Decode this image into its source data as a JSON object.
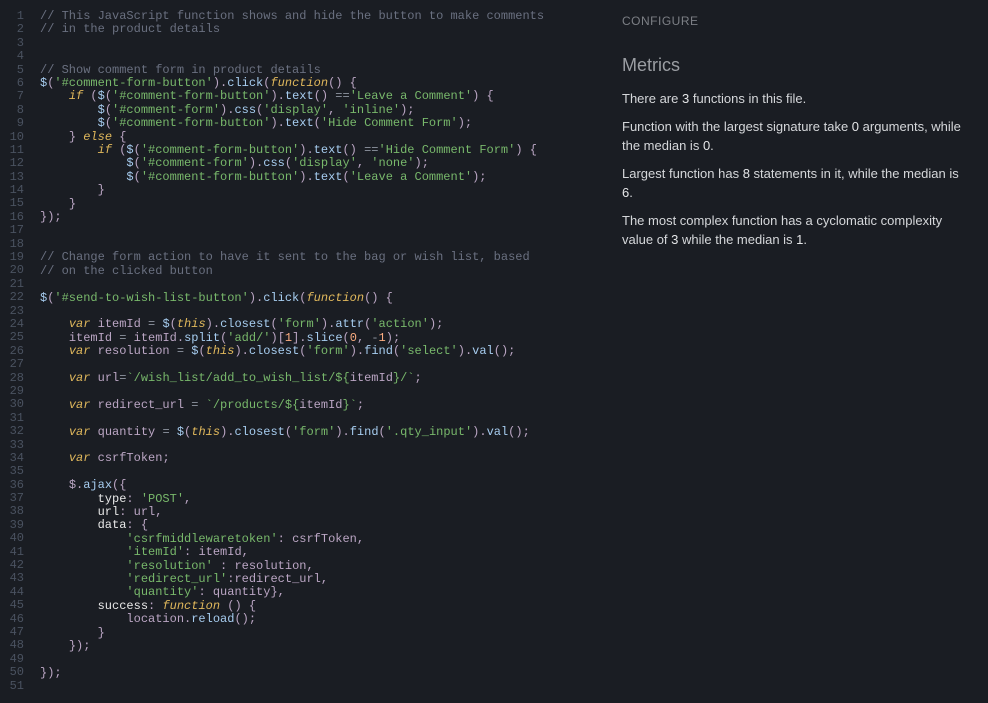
{
  "sidebar": {
    "configure_label": "CONFIGURE",
    "metrics_heading": "Metrics",
    "metrics": {
      "functions_count": 3,
      "largest_signature_args": 0,
      "median_args": 0,
      "largest_statements": 8,
      "median_statements": 6,
      "max_cyclomatic": 3,
      "median_cyclomatic": 1
    }
  },
  "code": {
    "line_count": 51,
    "lines": [
      [
        [
          "comment",
          "// This JavaScript function shows and hide the button to make comments"
        ]
      ],
      [
        [
          "comment",
          "// in the product details"
        ]
      ],
      [],
      [],
      [
        [
          "comment",
          "// Show comment form in product details"
        ]
      ],
      [
        [
          "fn",
          "$"
        ],
        [
          "punc",
          "("
        ],
        [
          "str",
          "'#comment-form-button'"
        ],
        [
          "punc",
          ")."
        ],
        [
          "fn",
          "click"
        ],
        [
          "punc",
          "("
        ],
        [
          "kw",
          "function"
        ],
        [
          "punc",
          "() {"
        ]
      ],
      [
        [
          "plain",
          "    "
        ],
        [
          "kw",
          "if"
        ],
        [
          "plain",
          " "
        ],
        [
          "punc",
          "("
        ],
        [
          "fn",
          "$"
        ],
        [
          "punc",
          "("
        ],
        [
          "str",
          "'#comment-form-button'"
        ],
        [
          "punc",
          ")."
        ],
        [
          "fn",
          "text"
        ],
        [
          "punc",
          "() "
        ],
        [
          "op",
          "=="
        ],
        [
          "str",
          "'Leave a Comment'"
        ],
        [
          "punc",
          ") {"
        ]
      ],
      [
        [
          "plain",
          "        "
        ],
        [
          "fn",
          "$"
        ],
        [
          "punc",
          "("
        ],
        [
          "str",
          "'#comment-form'"
        ],
        [
          "punc",
          ")."
        ],
        [
          "fn",
          "css"
        ],
        [
          "punc",
          "("
        ],
        [
          "str",
          "'display'"
        ],
        [
          "punc",
          ", "
        ],
        [
          "str",
          "'inline'"
        ],
        [
          "punc",
          ");"
        ]
      ],
      [
        [
          "plain",
          "        "
        ],
        [
          "fn",
          "$"
        ],
        [
          "punc",
          "("
        ],
        [
          "str",
          "'#comment-form-button'"
        ],
        [
          "punc",
          ")."
        ],
        [
          "fn",
          "text"
        ],
        [
          "punc",
          "("
        ],
        [
          "str",
          "'Hide Comment Form'"
        ],
        [
          "punc",
          ");"
        ]
      ],
      [
        [
          "plain",
          "    "
        ],
        [
          "punc",
          "} "
        ],
        [
          "kw",
          "else"
        ],
        [
          "plain",
          " "
        ],
        [
          "punc",
          "{"
        ]
      ],
      [
        [
          "plain",
          "        "
        ],
        [
          "kw",
          "if"
        ],
        [
          "plain",
          " "
        ],
        [
          "punc",
          "("
        ],
        [
          "fn",
          "$"
        ],
        [
          "punc",
          "("
        ],
        [
          "str",
          "'#comment-form-button'"
        ],
        [
          "punc",
          ")."
        ],
        [
          "fn",
          "text"
        ],
        [
          "punc",
          "() "
        ],
        [
          "op",
          "=="
        ],
        [
          "str",
          "'Hide Comment Form'"
        ],
        [
          "punc",
          ") {"
        ]
      ],
      [
        [
          "plain",
          "            "
        ],
        [
          "fn",
          "$"
        ],
        [
          "punc",
          "("
        ],
        [
          "str",
          "'#comment-form'"
        ],
        [
          "punc",
          ")."
        ],
        [
          "fn",
          "css"
        ],
        [
          "punc",
          "("
        ],
        [
          "str",
          "'display'"
        ],
        [
          "punc",
          ", "
        ],
        [
          "str",
          "'none'"
        ],
        [
          "punc",
          ");"
        ]
      ],
      [
        [
          "plain",
          "            "
        ],
        [
          "fn",
          "$"
        ],
        [
          "punc",
          "("
        ],
        [
          "str",
          "'#comment-form-button'"
        ],
        [
          "punc",
          ")."
        ],
        [
          "fn",
          "text"
        ],
        [
          "punc",
          "("
        ],
        [
          "str",
          "'Leave a Comment'"
        ],
        [
          "punc",
          ");"
        ]
      ],
      [
        [
          "plain",
          "        "
        ],
        [
          "punc",
          "}"
        ]
      ],
      [
        [
          "plain",
          "    "
        ],
        [
          "punc",
          "}"
        ]
      ],
      [
        [
          "punc",
          "});"
        ]
      ],
      [],
      [],
      [
        [
          "comment",
          "// Change form action to have it sent to the bag or wish list, based"
        ]
      ],
      [
        [
          "comment",
          "// on the clicked button"
        ]
      ],
      [],
      [
        [
          "fn",
          "$"
        ],
        [
          "punc",
          "("
        ],
        [
          "str",
          "'#send-to-wish-list-button'"
        ],
        [
          "punc",
          ")."
        ],
        [
          "fn",
          "click"
        ],
        [
          "punc",
          "("
        ],
        [
          "kw",
          "function"
        ],
        [
          "punc",
          "() {"
        ]
      ],
      [],
      [
        [
          "plain",
          "    "
        ],
        [
          "kw",
          "var"
        ],
        [
          "plain",
          " "
        ],
        [
          "ident",
          "itemId"
        ],
        [
          "plain",
          " "
        ],
        [
          "op",
          "="
        ],
        [
          "plain",
          " "
        ],
        [
          "fn",
          "$"
        ],
        [
          "punc",
          "("
        ],
        [
          "kw",
          "this"
        ],
        [
          "punc",
          ")."
        ],
        [
          "fn",
          "closest"
        ],
        [
          "punc",
          "("
        ],
        [
          "str",
          "'form'"
        ],
        [
          "punc",
          ")."
        ],
        [
          "fn",
          "attr"
        ],
        [
          "punc",
          "("
        ],
        [
          "str",
          "'action'"
        ],
        [
          "punc",
          ");"
        ]
      ],
      [
        [
          "plain",
          "    "
        ],
        [
          "ident",
          "itemId"
        ],
        [
          "plain",
          " "
        ],
        [
          "op",
          "="
        ],
        [
          "plain",
          " "
        ],
        [
          "ident",
          "itemId"
        ],
        [
          "punc",
          "."
        ],
        [
          "fn",
          "split"
        ],
        [
          "punc",
          "("
        ],
        [
          "str",
          "'add/'"
        ],
        [
          "punc",
          ")["
        ],
        [
          "num",
          "1"
        ],
        [
          "punc",
          "]."
        ],
        [
          "fn",
          "slice"
        ],
        [
          "punc",
          "("
        ],
        [
          "num",
          "0"
        ],
        [
          "punc",
          ", "
        ],
        [
          "op",
          "-"
        ],
        [
          "num",
          "1"
        ],
        [
          "punc",
          ");"
        ]
      ],
      [
        [
          "plain",
          "    "
        ],
        [
          "kw",
          "var"
        ],
        [
          "plain",
          " "
        ],
        [
          "ident",
          "resolution"
        ],
        [
          "plain",
          " "
        ],
        [
          "op",
          "="
        ],
        [
          "plain",
          " "
        ],
        [
          "fn",
          "$"
        ],
        [
          "punc",
          "("
        ],
        [
          "kw",
          "this"
        ],
        [
          "punc",
          ")."
        ],
        [
          "fn",
          "closest"
        ],
        [
          "punc",
          "("
        ],
        [
          "str",
          "'form'"
        ],
        [
          "punc",
          ")."
        ],
        [
          "fn",
          "find"
        ],
        [
          "punc",
          "("
        ],
        [
          "str",
          "'select'"
        ],
        [
          "punc",
          ")."
        ],
        [
          "fn",
          "val"
        ],
        [
          "punc",
          "();"
        ]
      ],
      [],
      [
        [
          "plain",
          "    "
        ],
        [
          "kw",
          "var"
        ],
        [
          "plain",
          " "
        ],
        [
          "ident",
          "url"
        ],
        [
          "op",
          "="
        ],
        [
          "str",
          "`/wish_list/add_to_wish_list/${"
        ],
        [
          "ident",
          "itemId"
        ],
        [
          "str",
          "}/`"
        ],
        [
          "punc",
          ";"
        ]
      ],
      [],
      [
        [
          "plain",
          "    "
        ],
        [
          "kw",
          "var"
        ],
        [
          "plain",
          " "
        ],
        [
          "ident",
          "redirect_url"
        ],
        [
          "plain",
          " "
        ],
        [
          "op",
          "="
        ],
        [
          "plain",
          " "
        ],
        [
          "str",
          "`/products/${"
        ],
        [
          "ident",
          "itemId"
        ],
        [
          "str",
          "}`"
        ],
        [
          "punc",
          ";"
        ]
      ],
      [],
      [
        [
          "plain",
          "    "
        ],
        [
          "kw",
          "var"
        ],
        [
          "plain",
          " "
        ],
        [
          "ident",
          "quantity"
        ],
        [
          "plain",
          " "
        ],
        [
          "op",
          "="
        ],
        [
          "plain",
          " "
        ],
        [
          "fn",
          "$"
        ],
        [
          "punc",
          "("
        ],
        [
          "kw",
          "this"
        ],
        [
          "punc",
          ")."
        ],
        [
          "fn",
          "closest"
        ],
        [
          "punc",
          "("
        ],
        [
          "str",
          "'form'"
        ],
        [
          "punc",
          ")."
        ],
        [
          "fn",
          "find"
        ],
        [
          "punc",
          "("
        ],
        [
          "str",
          "'.qty_input'"
        ],
        [
          "punc",
          ")."
        ],
        [
          "fn",
          "val"
        ],
        [
          "punc",
          "();"
        ]
      ],
      [],
      [
        [
          "plain",
          "    "
        ],
        [
          "kw",
          "var"
        ],
        [
          "plain",
          " "
        ],
        [
          "ident",
          "csrfToken"
        ],
        [
          "punc",
          ";"
        ]
      ],
      [],
      [
        [
          "plain",
          "    "
        ],
        [
          "ident",
          "$"
        ],
        [
          "punc",
          "."
        ],
        [
          "fn",
          "ajax"
        ],
        [
          "punc",
          "({"
        ]
      ],
      [
        [
          "plain",
          "        "
        ],
        [
          "prop",
          "type"
        ],
        [
          "punc",
          ": "
        ],
        [
          "str",
          "'POST'"
        ],
        [
          "punc",
          ","
        ]
      ],
      [
        [
          "plain",
          "        "
        ],
        [
          "prop",
          "url"
        ],
        [
          "punc",
          ": "
        ],
        [
          "ident",
          "url"
        ],
        [
          "punc",
          ","
        ]
      ],
      [
        [
          "plain",
          "        "
        ],
        [
          "prop",
          "data"
        ],
        [
          "punc",
          ": {"
        ]
      ],
      [
        [
          "plain",
          "            "
        ],
        [
          "str",
          "'csrfmiddlewaretoken'"
        ],
        [
          "punc",
          ": "
        ],
        [
          "ident",
          "csrfToken"
        ],
        [
          "punc",
          ","
        ]
      ],
      [
        [
          "plain",
          "            "
        ],
        [
          "str",
          "'itemId'"
        ],
        [
          "punc",
          ": "
        ],
        [
          "ident",
          "itemId"
        ],
        [
          "punc",
          ","
        ]
      ],
      [
        [
          "plain",
          "            "
        ],
        [
          "str",
          "'resolution'"
        ],
        [
          "plain",
          " "
        ],
        [
          "punc",
          ": "
        ],
        [
          "ident",
          "resolution"
        ],
        [
          "punc",
          ","
        ]
      ],
      [
        [
          "plain",
          "            "
        ],
        [
          "str",
          "'redirect_url'"
        ],
        [
          "punc",
          ":"
        ],
        [
          "ident",
          "redirect_url"
        ],
        [
          "punc",
          ","
        ]
      ],
      [
        [
          "plain",
          "            "
        ],
        [
          "str",
          "'quantity'"
        ],
        [
          "punc",
          ": "
        ],
        [
          "ident",
          "quantity"
        ],
        [
          "punc",
          "},"
        ]
      ],
      [
        [
          "plain",
          "        "
        ],
        [
          "prop",
          "success"
        ],
        [
          "punc",
          ": "
        ],
        [
          "kw",
          "function"
        ],
        [
          "plain",
          " "
        ],
        [
          "punc",
          "() {"
        ]
      ],
      [
        [
          "plain",
          "            "
        ],
        [
          "ident",
          "location"
        ],
        [
          "punc",
          "."
        ],
        [
          "fn",
          "reload"
        ],
        [
          "punc",
          "();"
        ]
      ],
      [
        [
          "plain",
          "        "
        ],
        [
          "punc",
          "}"
        ]
      ],
      [
        [
          "plain",
          "    "
        ],
        [
          "punc",
          "});"
        ]
      ],
      [],
      [
        [
          "punc",
          "});"
        ]
      ],
      []
    ]
  }
}
